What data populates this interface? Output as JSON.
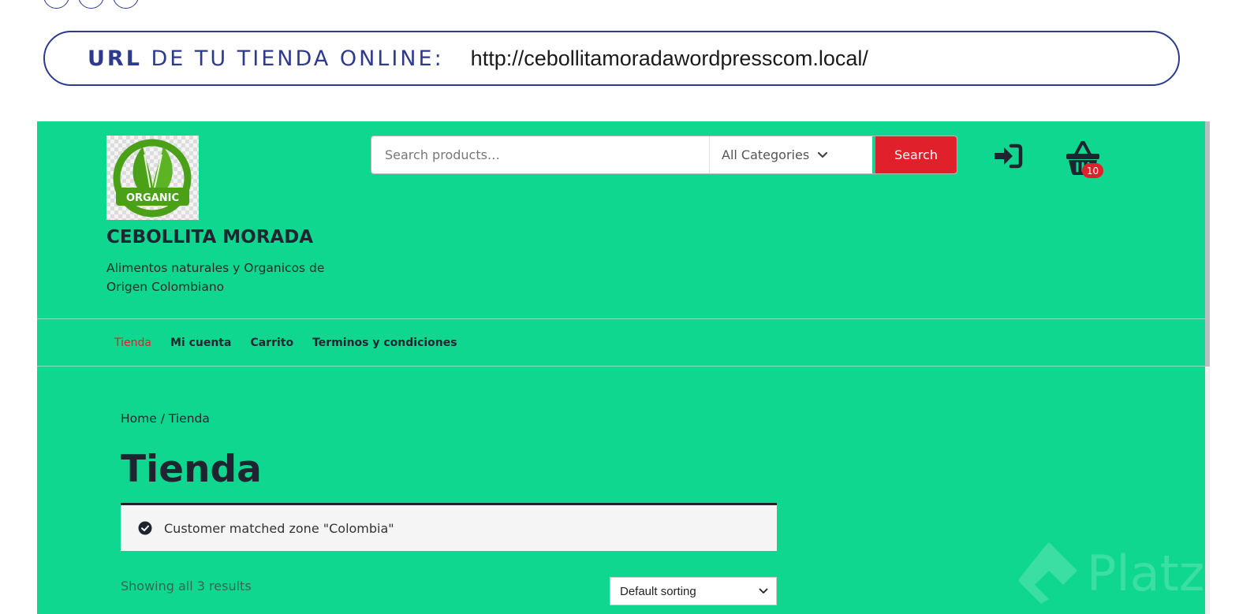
{
  "banner": {
    "url_label_bold": "URL",
    "url_label_rest": " DE TU TIENDA ONLINE:",
    "url_value": "http://cebollitamoradawordpresscom.local/"
  },
  "site": {
    "logo_text": "ORGANIC",
    "title": "CEBOLLITA MORADA",
    "tagline": "Alimentos naturales y Organicos de Origen Colombiano"
  },
  "search": {
    "placeholder": "Search products…",
    "category": "All Categories",
    "button_label": "Search"
  },
  "header_icons": {
    "login": "sign-in-icon",
    "cart": "basket-icon",
    "cart_count": "10"
  },
  "nav": {
    "items": [
      {
        "label": "Tienda",
        "active": true
      },
      {
        "label": "Mi cuenta"
      },
      {
        "label": "Carrito"
      },
      {
        "label": "Terminos y condiciones"
      }
    ]
  },
  "breadcrumb": {
    "home": "Home",
    "separator": " / ",
    "current": "Tienda"
  },
  "page": {
    "title": "Tienda"
  },
  "notice": {
    "text": "Customer matched zone \"Colombia\""
  },
  "shop": {
    "results": "Showing all 3 results",
    "sorting": "Default sorting"
  },
  "watermark": {
    "text": "Platzi"
  },
  "colors": {
    "site_bg": "#10d78f",
    "accent_red": "#e0202b",
    "banner_blue": "#2e3a8c",
    "text_dark": "#1f2430"
  }
}
